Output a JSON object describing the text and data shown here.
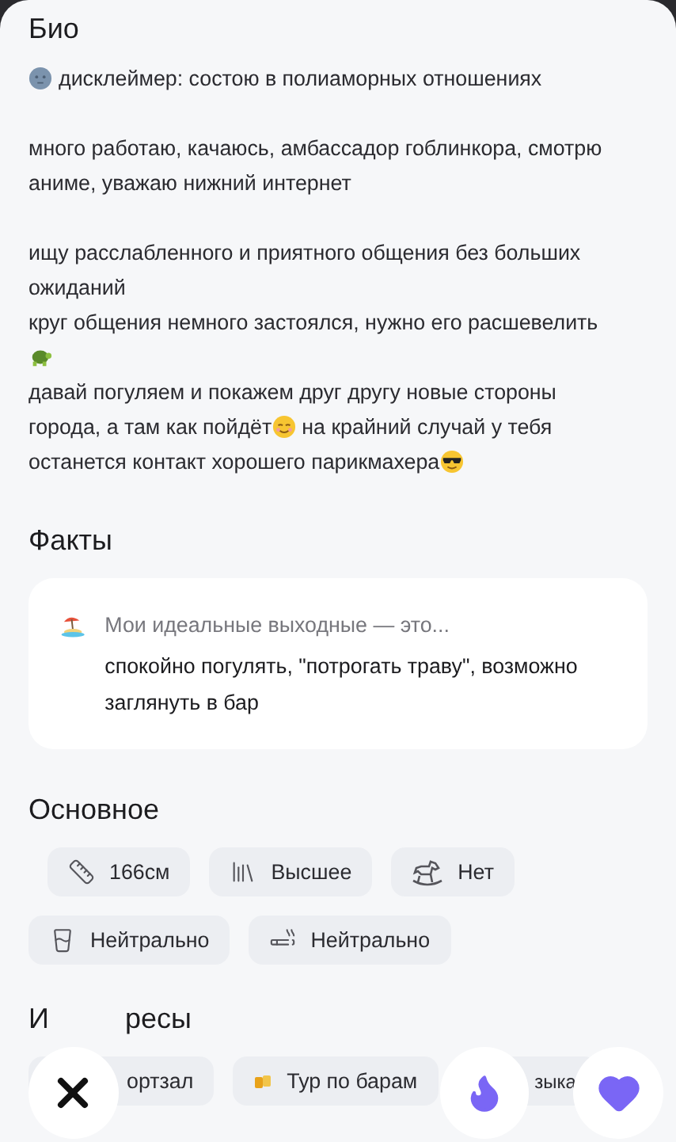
{
  "bio": {
    "title": "Био",
    "blocks": [
      {
        "lines": [
          [
            {
              "kind": "emoji"
            },
            {
              "kind": "text",
              "text": "дисклеймер: состою в полиаморных отношениях"
            }
          ]
        ]
      },
      {
        "lines": [
          [
            {
              "kind": "text",
              "text": "много работаю, качаюсь, амбассадор гоблинкора, смотрю"
            }
          ],
          [
            {
              "kind": "text",
              "text": "аниме, уважаю нижний интернет"
            }
          ]
        ]
      },
      {
        "lines": [
          [
            {
              "kind": "text",
              "text": "ищу расслабленного и приятного общения без больших"
            }
          ],
          [
            {
              "kind": "text",
              "text": "ожиданий"
            }
          ],
          [
            {
              "kind": "text",
              "text": "круг общения немного застоялся, нужно его расшевелить"
            }
          ],
          [
            {
              "kind": "emoji"
            }
          ],
          [
            {
              "kind": "text",
              "text": "давай погуляем и покажем друг другу новые стороны"
            }
          ],
          [
            {
              "kind": "text",
              "text": "города, а там как пойдёт"
            },
            {
              "kind": "emoji"
            },
            {
              "kind": "text",
              "text": "на крайний случай у тебя"
            }
          ],
          [
            {
              "kind": "text",
              "text": "останется контакт хорошего парикмахера"
            },
            {
              "kind": "emoji"
            }
          ]
        ]
      }
    ]
  },
  "facts": {
    "title": "Факты",
    "items": [
      {
        "question": "Мои идеальные выходные — это...",
        "answer": "спокойно погулять, \"потрогать траву\", возможно заглянуть в бар"
      }
    ]
  },
  "basics": {
    "title": "Основное",
    "rows": [
      [
        {
          "kind": "height",
          "label": "166см"
        },
        {
          "kind": "education",
          "label": "Высшее"
        },
        {
          "kind": "kids",
          "label": "Нет"
        }
      ],
      [
        {
          "kind": "alcohol",
          "label": "Нейтрально"
        },
        {
          "kind": "smoking",
          "label": "Нейтрально"
        }
      ]
    ]
  },
  "interests": {
    "title_parts": [
      "И",
      "ресы"
    ],
    "items": [
      {
        "label": "ортзал",
        "icon": false
      },
      {
        "label": "Тур по барам",
        "icon": true
      },
      {
        "label": "зыка",
        "icon": false
      }
    ]
  },
  "actions": [
    {
      "kind": "dislike"
    },
    {
      "kind": "superlike"
    },
    {
      "kind": "like"
    }
  ]
}
